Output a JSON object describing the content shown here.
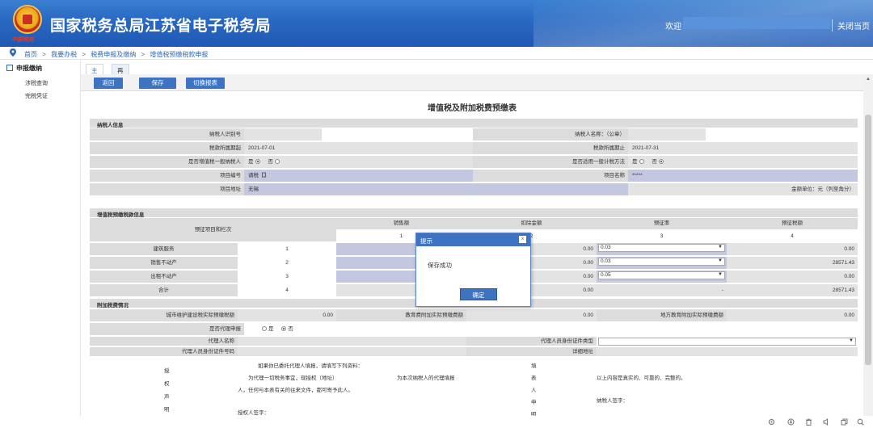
{
  "header": {
    "title": "国家税务总局江苏省电子税务局",
    "logo_text": "中国税务",
    "welcome": "欢迎",
    "close_page": "关闭当页"
  },
  "breadcrumb": [
    "首页",
    "我要办税",
    "税费申报及缴纳",
    "增值税预缴税款申报"
  ],
  "breadcrumb_sep": ">",
  "sidebar": {
    "head": "申报缴纳",
    "items": [
      "涉税查询",
      "完税凭证"
    ]
  },
  "tabs": {
    "home": "主页",
    "active": "再次申报 ×"
  },
  "toolbar": {
    "back": "返回",
    "save": "保存",
    "switch": "切换报表"
  },
  "form": {
    "title": "增值税及附加税费预缴表",
    "taxpayer_section": "纳税人信息",
    "taxpayer_id_label": "纳税人识别号",
    "taxpayer_id_value": "",
    "taxpayer_name_label": "纳税人名称：（公章）",
    "taxpayer_name_value": "",
    "period_start_label": "税款所属期起",
    "period_start_value": "2021-07-01",
    "period_end_label": "税款所属期止",
    "period_end_value": "2021-07-31",
    "general_taxpayer_label": "是否增值税一般纳税人",
    "simple_method_label": "是否适用一般计税方法",
    "yes": "是",
    "no": "否",
    "project_no_label": "项目编号",
    "project_no_value": "请税【】",
    "project_name_label": "项目名称",
    "project_name_value": "*****",
    "project_addr_label": "项目地址",
    "project_addr_value": "无锡",
    "unit_note": "金额单位：元（列至角分）",
    "prepay_section": "增值税预缴税款信息",
    "col_item": "预征项目和栏次",
    "col_sales": "销售额",
    "col_deduct": "扣除金额",
    "col_rate": "预征率",
    "col_tax": "预征税额",
    "col_nums": [
      "1",
      "2",
      "3",
      "4"
    ],
    "rows": [
      {
        "name": "建筑服务",
        "line": "1",
        "deduct": "0.00",
        "rate": "0.03",
        "tax": "0.00"
      },
      {
        "name": "销售不动产",
        "line": "2",
        "deduct": "0.00",
        "rate": "0.03",
        "tax": "28571.43"
      },
      {
        "name": "出租不动产",
        "line": "3",
        "deduct": "0.00",
        "rate": "0.05",
        "tax": "0.00"
      },
      {
        "name": "合计",
        "line": "4",
        "deduct": "0.00",
        "rate": "-",
        "tax": "28571.43"
      }
    ],
    "surtax_section": "附加税费情况",
    "urban_label": "城市维护建设税实际预缴税额",
    "urban_value": "0.00",
    "edu_label": "教育费附加实际预缴费额",
    "edu_value": "0.00",
    "local_edu_label": "地方教育附加实际预缴费额",
    "local_edu_value": "0.00",
    "agent_label": "是否代理申报",
    "agent_name_label": "代理人名称",
    "agent_id_type_label": "代理人员身份证件类型",
    "agent_id_no_label": "代理人员身份证件号码",
    "addr_label": "详细地址",
    "auth_chars": [
      "授",
      "权",
      "声",
      "明"
    ],
    "auth_line1": "如果你已委托代理人填报，请填写下列资料：",
    "auth_line2": "为代理一切税务事宜，现授权（地址）",
    "auth_line2b": "为本次纳税人的代理填报",
    "auth_line3": "人，任何与本表有关的往来文件，都可寄予此人。",
    "auth_line4": "授权人签字：",
    "fill_chars": [
      "填",
      "表",
      "人",
      "申",
      "明"
    ],
    "fill_line1": "以上内容是真实的、可靠的、完整的。",
    "fill_line2": "纳税人签字："
  },
  "modal": {
    "title": "提示",
    "close": "×",
    "message": "保存成功",
    "ok": "确定"
  },
  "icons": [
    "settings-icon",
    "download-icon",
    "delete-icon",
    "volume-icon",
    "copy-icon",
    "zoom-icon"
  ]
}
